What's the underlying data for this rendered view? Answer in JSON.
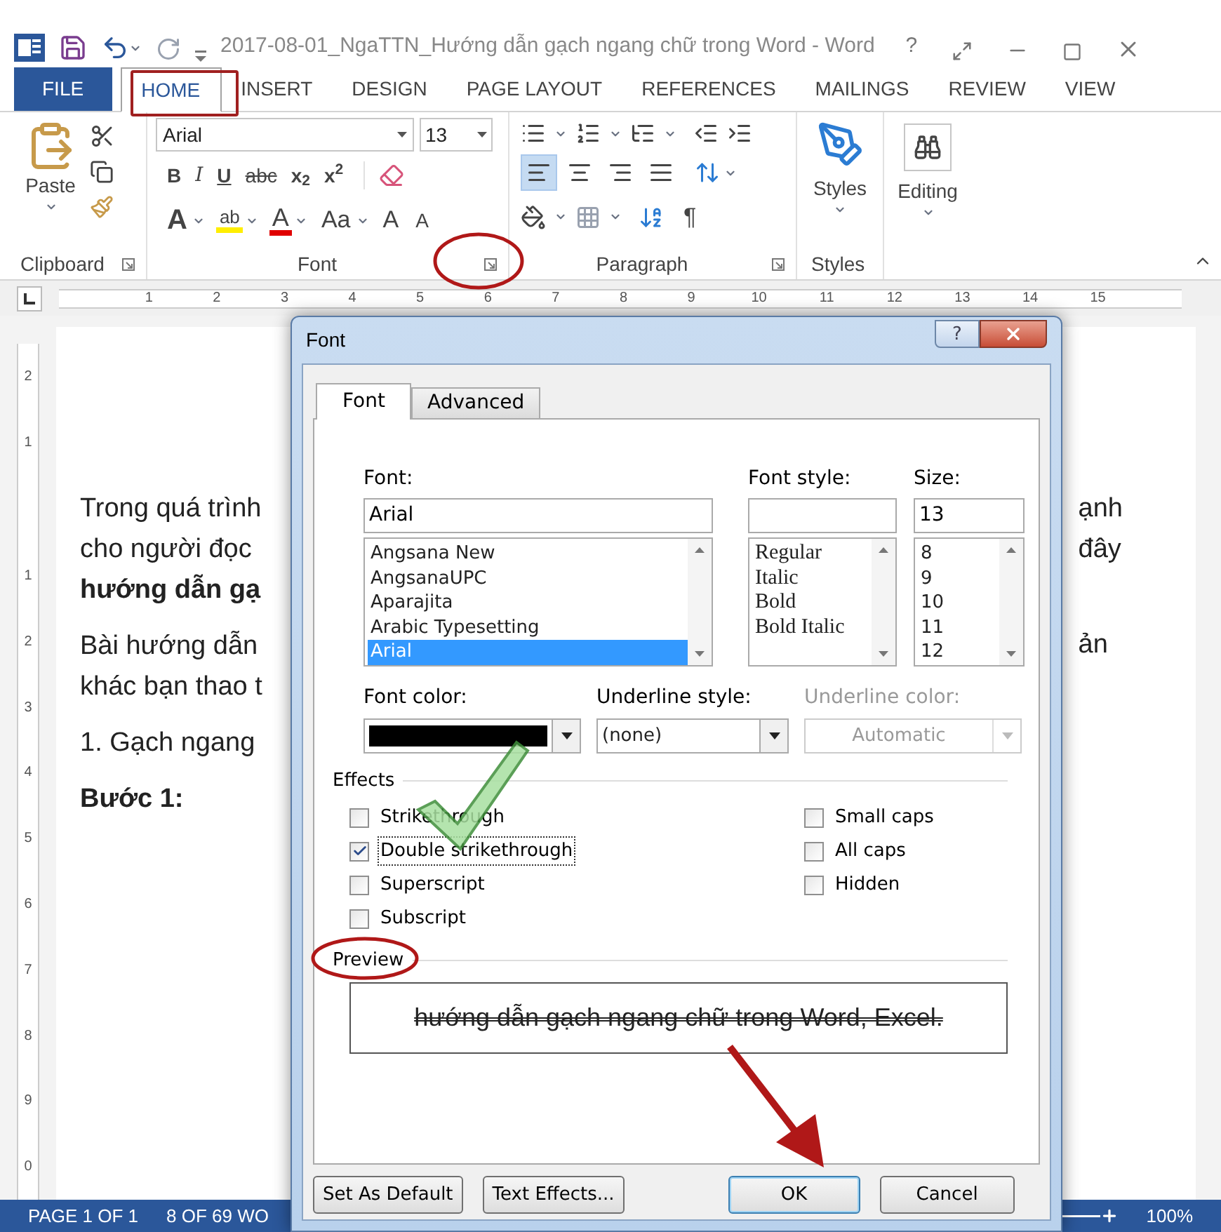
{
  "title_bar": {
    "title": "2017-08-01_NgaTTN_Hướng dẫn gạch ngang chữ trong Word - Word",
    "help": "?"
  },
  "ribbon_tabs": [
    {
      "label": "FILE",
      "kind": "file",
      "selected": false
    },
    {
      "label": "HOME",
      "kind": "tab",
      "selected": true
    },
    {
      "label": "INSERT",
      "kind": "tab",
      "selected": false
    },
    {
      "label": "DESIGN",
      "kind": "tab",
      "selected": false
    },
    {
      "label": "PAGE LAYOUT",
      "kind": "tab",
      "selected": false
    },
    {
      "label": "REFERENCES",
      "kind": "tab",
      "selected": false
    },
    {
      "label": "MAILINGS",
      "kind": "tab",
      "selected": false
    },
    {
      "label": "REVIEW",
      "kind": "tab",
      "selected": false
    },
    {
      "label": "VIEW",
      "kind": "tab",
      "selected": false
    }
  ],
  "ribbon": {
    "clipboard": {
      "paste": "Paste",
      "label": "Clipboard"
    },
    "font": {
      "font_name": "Arial",
      "font_size": "13",
      "format_buttons": [
        {
          "kind": "bold",
          "label": "B"
        },
        {
          "kind": "italic",
          "label": "I"
        },
        {
          "kind": "underline",
          "label": "U"
        },
        {
          "kind": "strike",
          "label": "abc"
        },
        {
          "kind": "plain",
          "label": "x$_{2}$"
        },
        {
          "kind": "plain",
          "label": "x$^{2}$"
        }
      ],
      "style_buttons": [
        {
          "kind": "effects",
          "label": "A"
        },
        {
          "kind": "highlight",
          "label": "ab"
        },
        {
          "kind": "color",
          "label": "A"
        },
        {
          "kind": "case",
          "label": "Aa"
        },
        {
          "kind": "grow",
          "label": "A"
        },
        {
          "kind": "shrink",
          "label": "A"
        }
      ],
      "label": "Font"
    },
    "paragraph": {
      "align_buttons": [
        {
          "selected": true
        },
        {
          "selected": false
        },
        {
          "selected": false
        },
        {
          "selected": false
        }
      ],
      "pilcrow": "¶",
      "label": "Paragraph"
    },
    "styles": {
      "button": "Styles",
      "label": "Styles"
    },
    "editing": {
      "button": "Editing"
    }
  },
  "ruler": {
    "numbers": [
      "1",
      "2",
      "3",
      "4",
      "5",
      "6",
      "7",
      "8",
      "9",
      "10",
      "11",
      "12",
      "13",
      "14",
      "15"
    ]
  },
  "vertical_ruler": {
    "numbers": [
      "2",
      "1",
      "1",
      "2",
      "3",
      "4",
      "5",
      "6",
      "7",
      "8",
      "9",
      "0"
    ]
  },
  "document": {
    "left_lines": [
      {
        "text": "Trong quá trình",
        "bold": false
      },
      {
        "text": "cho người đọc",
        "bold": false
      },
      {
        "text": "hướng dẫn gạ",
        "bold": true
      },
      {
        "text": "Bài hướng dẫn",
        "bold": false
      },
      {
        "text": "khác bạn thao t",
        "bold": false
      },
      {
        "text": "1. Gạch ngang",
        "bold": false
      },
      {
        "text": "Bước 1:",
        "bold": true
      }
    ],
    "right_lines": [
      "ạnh",
      "đây",
      "ản"
    ]
  },
  "dialog": {
    "title": "Font",
    "help": "?",
    "tabs": [
      {
        "label": "Font",
        "selected": true
      },
      {
        "label": "Advanced",
        "selected": false
      }
    ],
    "font": {
      "label": "Font:",
      "value": "Arial",
      "items": [
        {
          "label": "Angsana New",
          "selected": false
        },
        {
          "label": "AngsanaUPC",
          "selected": false
        },
        {
          "label": "Aparajita",
          "selected": false
        },
        {
          "label": "Arabic Typesetting",
          "selected": false
        },
        {
          "label": "Arial",
          "selected": true
        }
      ]
    },
    "font_style": {
      "label": "Font style:",
      "items": [
        {
          "label": "Regular",
          "selected": false
        },
        {
          "label": "Italic",
          "selected": false
        },
        {
          "label": "Bold",
          "selected": false
        },
        {
          "label": "Bold Italic",
          "selected": false
        }
      ]
    },
    "size": {
      "label": "Size:",
      "value": "13",
      "items": [
        {
          "label": "8",
          "selected": false
        },
        {
          "label": "9",
          "selected": false
        },
        {
          "label": "10",
          "selected": false
        },
        {
          "label": "11",
          "selected": false
        },
        {
          "label": "12",
          "selected": false
        }
      ]
    },
    "font_color": {
      "label": "Font color:",
      "color": "#000000"
    },
    "underline_style": {
      "label": "Underline style:",
      "value": "(none)",
      "disabled": false
    },
    "underline_color": {
      "label": "Underline color:",
      "value": "Automatic",
      "disabled": true
    },
    "effects": {
      "label": "Effects",
      "left": [
        {
          "label": "Strikethrough",
          "checked": false,
          "focused": false
        },
        {
          "label": "Double strikethrough",
          "checked": true,
          "focused": true
        },
        {
          "label": "Superscript",
          "checked": false,
          "focused": false
        },
        {
          "label": "Subscript",
          "checked": false,
          "focused": false
        }
      ],
      "right": [
        {
          "label": "Small caps",
          "checked": false,
          "focused": false
        },
        {
          "label": "All caps",
          "checked": false,
          "focused": false
        },
        {
          "label": "Hidden",
          "checked": false,
          "focused": false
        }
      ]
    },
    "preview": {
      "label": "Preview",
      "text": "hướng dẫn gạch ngang chữ trong Word, Excel."
    },
    "buttons": [
      {
        "label": "Set As Default",
        "default": false
      },
      {
        "label": "Text Effects...",
        "default": false
      },
      {
        "label": "OK",
        "default": true
      },
      {
        "label": "Cancel",
        "default": false
      }
    ]
  },
  "status_bar": {
    "page": "PAGE 1 OF 1",
    "words": "8 OF 69 WO",
    "zoom": "100%"
  }
}
